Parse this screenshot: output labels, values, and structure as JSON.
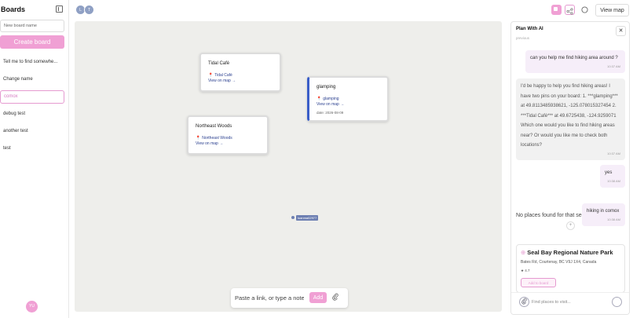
{
  "sidebar": {
    "title": "Boards",
    "new_board_placeholder": "New board name",
    "create_label": "Create board",
    "boards": [
      {
        "label": "Tell me to find somewhe..."
      },
      {
        "label": "Change name"
      },
      {
        "label": "comox"
      },
      {
        "label": "debug test"
      },
      {
        "label": "another test"
      },
      {
        "label": "test"
      }
    ],
    "active_board": "comox",
    "user_initials": "YU"
  },
  "topbar": {
    "presence": [
      "L",
      "T"
    ],
    "view_map_label": "View map"
  },
  "canvas": {
    "cards": [
      {
        "title": "Tidal Café",
        "place": "Tidal Café",
        "link": "View on map →"
      },
      {
        "title": "glamping",
        "place": "glamping",
        "link": "View on map →",
        "date": "date: 2026-08-09"
      },
      {
        "title": "Northeast Woods",
        "place": "Northeast Woods",
        "link": "View on map →"
      }
    ],
    "cursor_label": "luanma02977"
  },
  "composer": {
    "placeholder": "Paste a link, or type a note",
    "add_label": "Add"
  },
  "chat": {
    "title": "Plan With AI",
    "close_label": "✕",
    "truncated_top": "previous",
    "messages": [
      {
        "role": "user",
        "text": "can you help me find hiking area around ?",
        "time": "10:37 AM"
      },
      {
        "role": "ai",
        "text": "I'd be happy to help you find hiking areas! I have two pins on your board: 1. ***glamping*** at 49.8113485938621, -125.07801532745​4 2. ***Tidal Café*** at 49.6725438, -124.9259071 Which one would you like to find hiking areas near? Or would you like me to check both locations?",
        "time": "10:37 AM"
      },
      {
        "role": "user",
        "text": "yes",
        "time": "10:38 AM"
      },
      {
        "role": "user",
        "text": "hiking in comox",
        "time": "10:38 AM"
      }
    ],
    "no_places": "No places found for that search.",
    "place": {
      "name": "Seal Bay Regional Nature Park",
      "address": "Bates Rd, Courtenay, BC V9J 1X4, Canada",
      "rating": "★ 4.7",
      "add_label": "Add to board"
    },
    "input_placeholder": "Find places to visit..."
  },
  "colors": {
    "accent": "#f0a0d4",
    "canvas_bg": "#eeeeeb",
    "link": "#2a3f8f"
  }
}
